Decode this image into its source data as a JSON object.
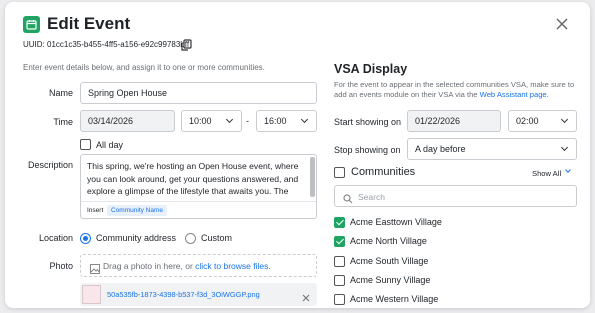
{
  "header": {
    "title": "Edit Event",
    "uuid": "UUID: 01cc1c35-b455-4ff5-a156-e92c99783bff"
  },
  "intro": "Enter event details below, and assign it to one or more communities.",
  "form": {
    "name_label": "Name",
    "name_value": "Spring Open House",
    "time_label": "Time",
    "date_value": "03/14/2026",
    "start_time": "10:00",
    "separator": "-",
    "end_time": "16:00",
    "allday_label": "All day",
    "description_label": "Description",
    "description_value": "This spring, we're hosting an Open House event, where you can look around, get your questions answered, and explore a glimpse of the lifestyle that awaits you. The",
    "insert_label": "Insert",
    "insert_tag": "Community Name",
    "location_label": "Location",
    "location_options": [
      "Community address",
      "Custom"
    ],
    "location_selected": "Community address",
    "photo_label": "Photo",
    "photo_drop_prefix": "Drag a photo in here, or",
    "photo_drop_link": "click to browse files.",
    "photo_file": "50a535fb-1873-4398-b537-f3d_3OiWGGP.png"
  },
  "vsa": {
    "title": "VSA Display",
    "desc_prefix": "For the event to appear in the selected communities VSA, make sure to add an events module on their VSA via the",
    "desc_link": "Web Assistant page.",
    "start_label": "Start showing on",
    "start_date": "01/22/2026",
    "start_time": "02:00",
    "stop_label": "Stop showing on",
    "stop_value": "A day before",
    "communities_label": "Communities",
    "show_all": "Show All",
    "search_placeholder": "Search",
    "communities": [
      {
        "name": "Acme Easttown Village",
        "checked": true
      },
      {
        "name": "Acme North Village",
        "checked": true
      },
      {
        "name": "Acme South Village",
        "checked": false
      },
      {
        "name": "Acme Sunny Village",
        "checked": false
      },
      {
        "name": "Acme Western Village",
        "checked": false
      }
    ]
  },
  "colors": {
    "accent": "#1fa463",
    "link": "#1a73e8"
  },
  "icons": [
    "calendar-icon",
    "close-icon",
    "copy-icon",
    "chevron-down-icon",
    "search-icon",
    "image-icon",
    "remove-icon"
  ]
}
